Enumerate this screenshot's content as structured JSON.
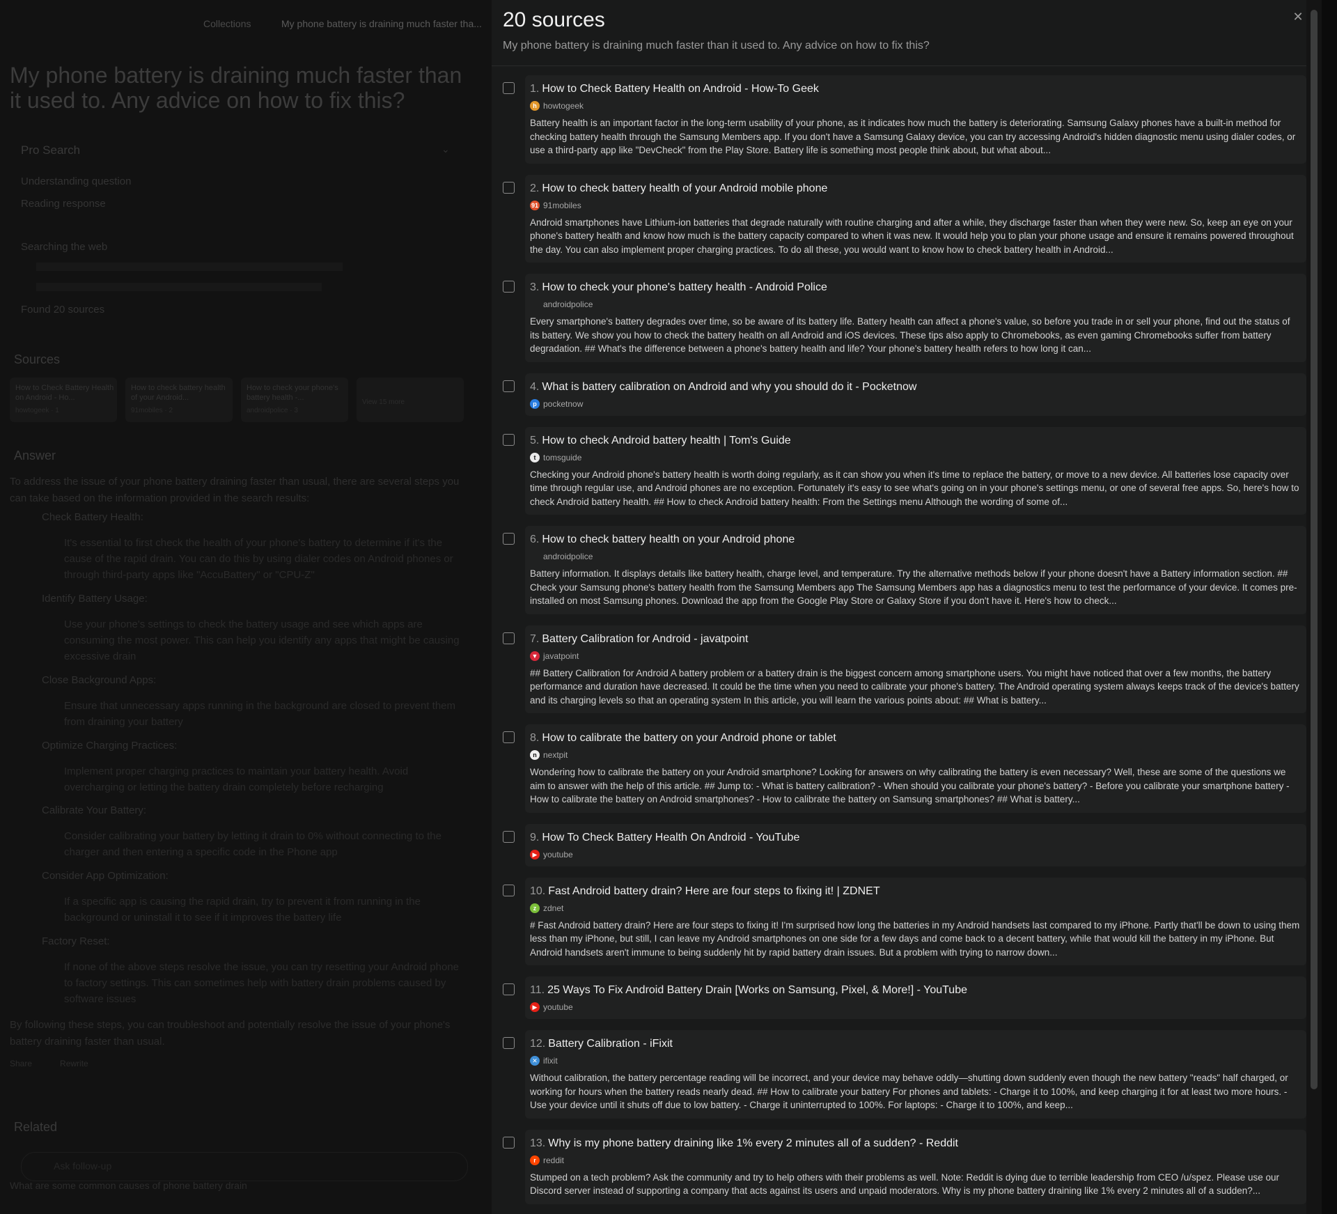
{
  "background": {
    "breadcrumb": "Collections",
    "breadcrumb_current": "My phone battery is draining much faster tha...",
    "question": "My phone battery is draining much faster than it used to. Any advice on how to fix this?",
    "pro_search_label": "Pro Search",
    "steps": [
      "Understanding question",
      "Reading response",
      "Searching the web",
      "Found 20 sources"
    ],
    "sources_label": "Sources",
    "source_cards": [
      {
        "title": "How to Check Battery Health on Android - Ho...",
        "site": "howtogeek · 1"
      },
      {
        "title": "How to check battery health of your Android...",
        "site": "91mobiles · 2"
      },
      {
        "title": "How to check your phone's battery health -...",
        "site": "androidpolice · 3"
      },
      {
        "title": "",
        "site": "View 15 more"
      }
    ],
    "answer_label": "Answer",
    "answer_intro": "To address the issue of your phone battery draining faster than usual, there are several steps you can take based on the information provided in the search results:",
    "answer_items": [
      {
        "heading": "Check Battery Health:",
        "text": "It's essential to first check the health of your phone's battery to determine if it's the cause of the rapid drain. You can do this by using dialer codes on Android phones or through third-party apps like \"AccuBattery\" or \"CPU-Z\""
      },
      {
        "heading": "Identify Battery Usage:",
        "text": "Use your phone's settings to check the battery usage and see which apps are consuming the most power. This can help you identify any apps that might be causing excessive drain"
      },
      {
        "heading": "Close Background Apps:",
        "text": "Ensure that unnecessary apps running in the background are closed to prevent them from draining your battery"
      },
      {
        "heading": "Optimize Charging Practices:",
        "text": "Implement proper charging practices to maintain your battery health. Avoid overcharging or letting the battery drain completely before recharging"
      },
      {
        "heading": "Calibrate Your Battery:",
        "text": "Consider calibrating your battery by letting it drain to 0% without connecting to the charger and then entering a specific code in the Phone app"
      },
      {
        "heading": "Consider App Optimization:",
        "text": "If a specific app is causing the rapid drain, try to prevent it from running in the background or uninstall it to see if it improves the battery life"
      },
      {
        "heading": "Factory Reset:",
        "text": "If none of the above steps resolve the issue, you can try resetting your Android phone to factory settings. This can sometimes help with battery drain problems caused by software issues"
      }
    ],
    "answer_outro": "By following these steps, you can troubleshoot and potentially resolve the issue of your phone's battery draining faster than usual.",
    "share_label": "Share",
    "rewrite_label": "Rewrite",
    "related_label": "Related",
    "related_questions": [
      "What are some common causes of phone battery drain"
    ],
    "follow_up_placeholder": "Ask follow-up"
  },
  "panel": {
    "title": "20 sources",
    "subtitle": "My phone battery is draining much faster than it used to. Any advice on how to fix this?",
    "close_glyph": "✕",
    "sources": [
      {
        "num": "1.",
        "title": "How to Check Battery Health on Android - How-To Geek",
        "site": "howtogeek",
        "fav_color": "#e0962a",
        "fav_glyph": "h",
        "snippet": "Battery health is an important factor in the long-term usability of your phone, as it indicates how much the battery is deteriorating. Samsung Galaxy phones have a built-in method for checking battery health through the Samsung Members app. If you don't have a Samsung Galaxy device, you can try accessing Android's hidden diagnostic menu using dialer codes, or use a third-party app like \"DevCheck\" from the Play Store. Battery life is something most people think about, but what about..."
      },
      {
        "num": "2.",
        "title": "How to check battery health of your Android mobile phone",
        "site": "91mobiles",
        "fav_color": "#e0502a",
        "fav_glyph": "91",
        "snippet": "Android smartphones have Lithium-ion batteries that degrade naturally with routine charging and after a while, they discharge faster than when they were new. So, keep an eye on your phone's battery health and know how much is the battery capacity compared to when it was new. It would help you to plan your phone usage and ensure it remains powered throughout the day. You can also implement proper charging practices. To do all these, you would want to know how to check battery health in Android..."
      },
      {
        "num": "3.",
        "title": "How to check your phone's battery health - Android Police",
        "site": "androidpolice",
        "fav_color": "",
        "fav_glyph": "",
        "snippet": "Every smartphone's battery degrades over time, so be aware of its battery life. Battery health can affect a phone's value, so before you trade in or sell your phone, find out the status of its battery. We show you how to check the battery health on all Android and iOS devices. These tips also apply to Chromebooks, as even gaming Chromebooks suffer from battery degradation. ## What's the difference between a phone's battery health and life? Your phone's battery health refers to how long it can..."
      },
      {
        "num": "4.",
        "title": "What is battery calibration on Android and why you should do it - Pocketnow",
        "site": "pocketnow",
        "fav_color": "#2a7de0",
        "fav_glyph": "p",
        "snippet": ""
      },
      {
        "num": "5.",
        "title": "How to check Android battery health | Tom's Guide",
        "site": "tomsguide",
        "fav_color": "#eaeaea",
        "fav_glyph": "t",
        "snippet": "Checking your Android phone's battery health is worth doing regularly, as it can show you when it's time to replace the battery, or move to a new device. All batteries lose capacity over time through regular use, and Android phones are no exception. Fortunately it's easy to see what's going on in your phone's settings menu, or one of several free apps. So, here's how to check Android battery health. ## How to check Android battery health: From the Settings menu Although the wording of some of..."
      },
      {
        "num": "6.",
        "title": "How to check battery health on your Android phone",
        "site": "androidpolice",
        "fav_color": "",
        "fav_glyph": "",
        "snippet": "Battery information. It displays details like battery health, charge level, and temperature. Try the alternative methods below if your phone doesn't have a Battery information section. ## Check your Samsung phone's battery health from the Samsung Members app The Samsung Members app has a diagnostics menu to test the performance of your device. It comes pre-installed on most Samsung phones. Download the app from the Google Play Store or Galaxy Store if you don't have it. Here's how to check..."
      },
      {
        "num": "7.",
        "title": "Battery Calibration for Android - javatpoint",
        "site": "javatpoint",
        "fav_color": "#d8283a",
        "fav_glyph": "▼",
        "snippet": "## Battery Calibration for Android A battery problem or a battery drain is the biggest concern among smartphone users. You might have noticed that over a few months, the battery performance and duration have decreased. It could be the time when you need to calibrate your phone's battery. The Android operating system always keeps track of the device's battery and its charging levels so that an operating system In this article, you will learn the various points about: ## What is battery..."
      },
      {
        "num": "8.",
        "title": "How to calibrate the battery on your Android phone or tablet",
        "site": "nextpit",
        "fav_color": "#f0f0f0",
        "fav_glyph": "n",
        "snippet": "Wondering how to calibrate the battery on your Android smartphone? Looking for answers on why calibrating the battery is even necessary? Well, these are some of the questions we aim to answer with the help of this article. ## Jump to: - What is battery calibration? - When should you calibrate your phone's battery? - Before you calibrate your smartphone battery - How to calibrate the battery on Android smartphones? - How to calibrate the battery on Samsung smartphones? ## What is battery..."
      },
      {
        "num": "9.",
        "title": "How To Check Battery Health On Android - YouTube",
        "site": "youtube",
        "fav_color": "#e62117",
        "fav_glyph": "▶",
        "snippet": ""
      },
      {
        "num": "10.",
        "title": "Fast Android battery drain? Here are four steps to fixing it! | ZDNET",
        "site": "zdnet",
        "fav_color": "#7cbf3a",
        "fav_glyph": "z",
        "snippet": "# Fast Android battery drain? Here are four steps to fixing it! I'm surprised how long the batteries in my Android handsets last compared to my iPhone. Partly that'll be down to using them less than my iPhone, but still, I can leave my Android smartphones on one side for a few days and come back to a decent battery, while that would kill the battery in my iPhone. But Android handsets aren't immune to being suddenly hit by rapid battery drain issues. But a problem with trying to narrow down..."
      },
      {
        "num": "11.",
        "title": "25 Ways To Fix Android Battery Drain [Works on Samsung, Pixel, & More!] - YouTube",
        "site": "youtube",
        "fav_color": "#e62117",
        "fav_glyph": "▶",
        "snippet": ""
      },
      {
        "num": "12.",
        "title": "Battery Calibration - iFixit",
        "site": "ifixit",
        "fav_color": "#3f8fd8",
        "fav_glyph": "✕",
        "snippet": "Without calibration, the battery percentage reading will be incorrect, and your device may behave oddly—shutting down suddenly even though the new battery \"reads\" half charged, or working for hours when the battery reads nearly dead. ## How to calibrate your battery For phones and tablets: - Charge it to 100%, and keep charging it for at least two more hours. - Use your device until it shuts off due to low battery. - Charge it uninterrupted to 100%. For laptops: - Charge it to 100%, and keep..."
      },
      {
        "num": "13.",
        "title": "Why is my phone battery draining like 1% every 2 minutes all of a sudden? - Reddit",
        "site": "reddit",
        "fav_color": "#ff4500",
        "fav_glyph": "r",
        "snippet": "Stumped on a tech problem? Ask the community and try to help others with their problems as well. Note: Reddit is dying due to terrible leadership from CEO /u/spez. Please use our Discord server instead of supporting a company that acts against its users and unpaid moderators. Why is my phone battery draining like 1% every 2 minutes all of a sudden?..."
      }
    ]
  }
}
